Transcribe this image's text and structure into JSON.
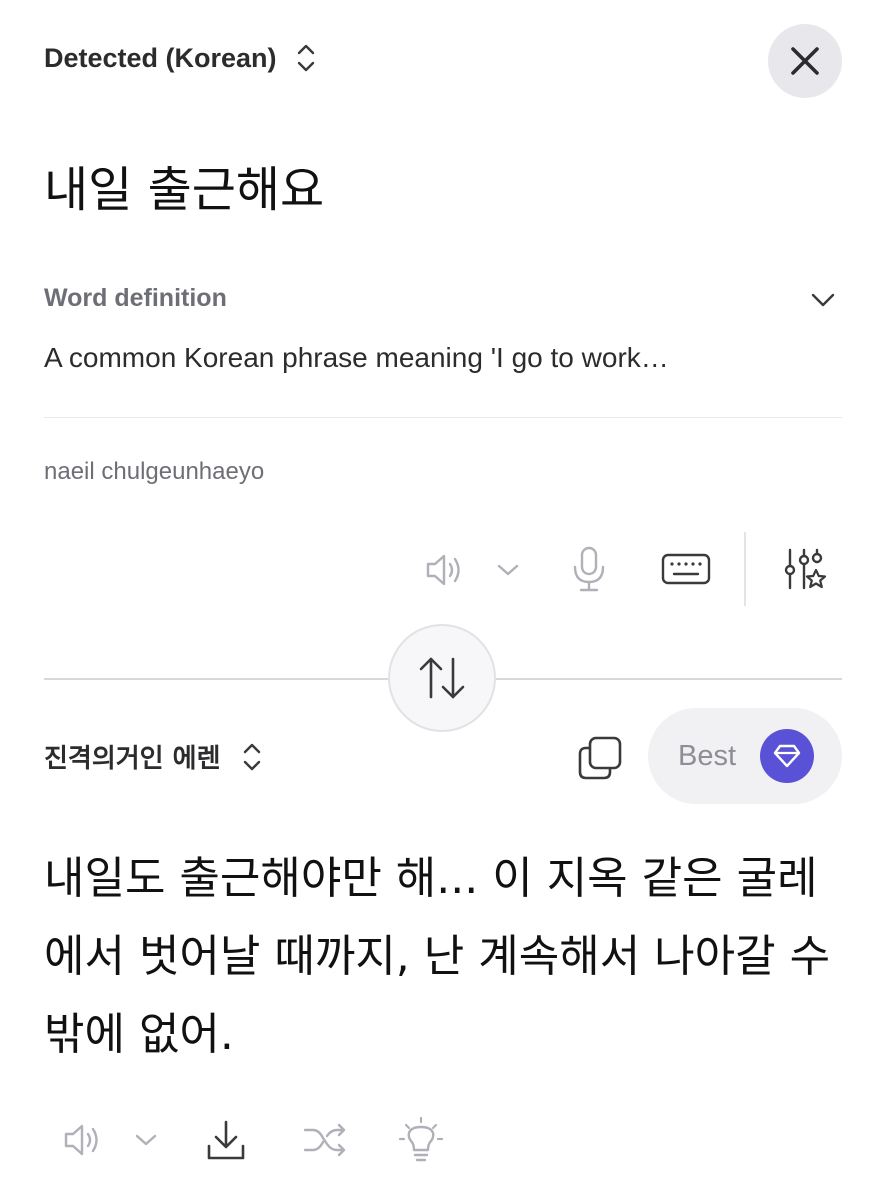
{
  "source": {
    "language_label": "Detected (Korean)",
    "text": "내일 출근해요",
    "definition_title": "Word definition",
    "definition_text": "A common Korean phrase meaning 'I go to work…",
    "romanization": "naeil chulgeunhaeyo"
  },
  "target": {
    "language_label": "진격의거인 에렌",
    "best_label": "Best",
    "text": "내일도 출근해야만 해... 이 지옥 같은 굴레에서 벗어날 때까지, 난 계속해서 나아갈 수밖에 없어."
  },
  "icons": {
    "close": "close-icon",
    "speaker": "speaker-icon",
    "microphone": "microphone-icon",
    "keyboard": "keyboard-icon",
    "settings": "sliders-star-icon",
    "swap": "swap-icon",
    "copy": "copy-icon",
    "gem": "gem-icon",
    "download": "download-icon",
    "shuffle": "shuffle-icon",
    "bulb": "lightbulb-icon"
  },
  "colors": {
    "accent": "#5a52d6",
    "icon_muted": "#b0b0b8",
    "icon_dark": "#3a3a3c"
  }
}
